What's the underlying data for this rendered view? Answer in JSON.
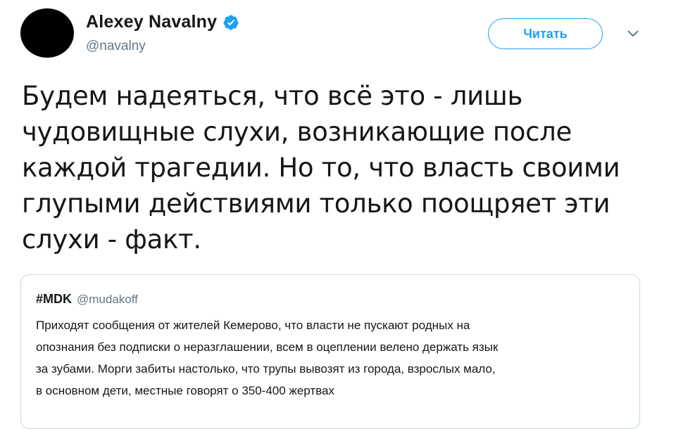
{
  "author": {
    "display_name": "Alexey Navalny",
    "handle": "@navalny",
    "verified": true
  },
  "actions": {
    "follow_label": "Читать",
    "more_icon": "chevron-down-icon"
  },
  "tweet": {
    "text_lines": [
      "Будем надеяться, что всё это - лишь",
      "чудовищные слухи, возникающие после",
      "каждой трагедии. Но то, что власть своими",
      "глупыми действиями только поощряет эти",
      "слухи - факт."
    ]
  },
  "quoted_tweet": {
    "display_name": "#MDK",
    "handle": "@mudakoff",
    "text_lines": [
      "Приходят сообщения от жителей Кемерово, что власти не пускают родных на",
      "опознания без подписки о неразглашении, всем в оцеплении велено держать язык",
      "за зубами. Морги забиты настолько, что трупы вывозят из города, взрослых мало,",
      "в основном дети, местные говорят о 350-400 жертвах"
    ]
  },
  "colors": {
    "accent": "#1da1f2",
    "text": "#14171a",
    "secondary_text": "#657786",
    "border": "#ccd6dd"
  }
}
